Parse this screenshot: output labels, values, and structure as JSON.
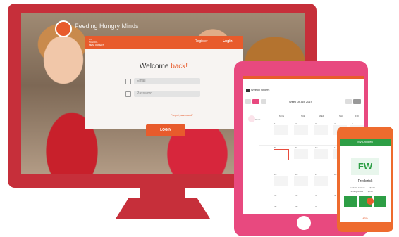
{
  "monitor": {
    "app_brand": "Feeding Hungry Minds",
    "login_panel": {
      "header_note": "MY\nSCHOOL\nMEAL ORDERS",
      "tab_register": "Register",
      "tab_login": "Login",
      "welcome_prefix": "Welcome",
      "welcome_accent": "back!",
      "email_placeholder": "Email",
      "password_placeholder": "Password",
      "forgot_link": "Forgot password?",
      "login_button": "LOGIN"
    }
  },
  "tablet": {
    "title": "Weekly Orders",
    "week_label": "Week 08 Apr 2019",
    "days": [
      "MON",
      "TUE",
      "WED",
      "THU",
      "FRI"
    ],
    "filter_label": "Items",
    "dates_row1": [
      "1",
      "2",
      "3",
      "4",
      "5"
    ],
    "dates_row2": [
      "8",
      "9",
      "10",
      "11",
      "12"
    ],
    "dates_row3": [
      "15",
      "16",
      "17",
      "18",
      "19"
    ],
    "dates_row4": [
      "22",
      "23",
      "24",
      "25",
      "26"
    ],
    "dates_row5": [
      "29",
      "30",
      "31"
    ]
  },
  "phone": {
    "header": "My Children",
    "initials": "FW",
    "name": "Frederick",
    "stat_1_label": "Available balance",
    "stat_1_value": "$7.00",
    "stat_2_label": "Pending orders",
    "stat_2_value": "$0.00",
    "bottom_label": "ADD"
  },
  "colors": {
    "monitor": "#c62f3a",
    "accent_orange": "#e85b2c",
    "tablet": "#e8497f",
    "phone": "#ee6b2e",
    "phone_green": "#2d9e45"
  }
}
